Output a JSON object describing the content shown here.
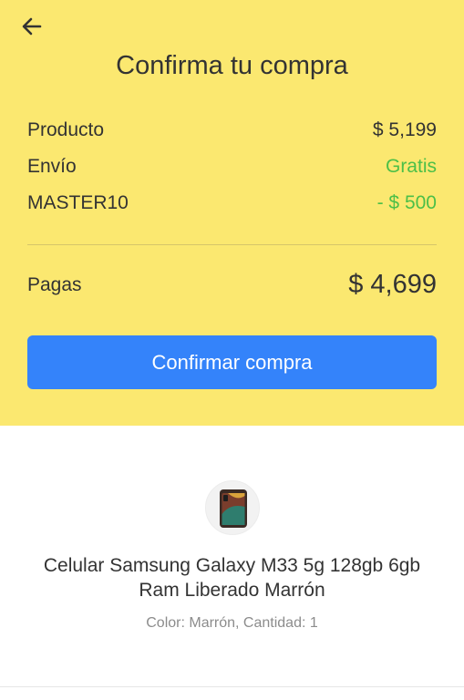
{
  "header": {
    "back_icon": "arrow-left-icon",
    "title": "Confirma tu compra"
  },
  "summary": {
    "rows": [
      {
        "label": "Producto",
        "value": "$ 5,199"
      },
      {
        "label": "Envío",
        "value": "Gratis"
      },
      {
        "label": "MASTER10",
        "value": "- $ 500"
      }
    ],
    "total_label": "Pagas",
    "total_value": "$ 4,699",
    "colors": {
      "background": "#fbe870",
      "discount": "#4cbf48",
      "button": "#3483fa"
    }
  },
  "actions": {
    "confirm_label": "Confirmar compra"
  },
  "product": {
    "image_icon": "smartphone-thumbnail",
    "name": "Celular Samsung Galaxy M33 5g 128gb 6gb Ram Liberado Marrón",
    "meta": "Color: Marrón, Cantidad: 1"
  }
}
